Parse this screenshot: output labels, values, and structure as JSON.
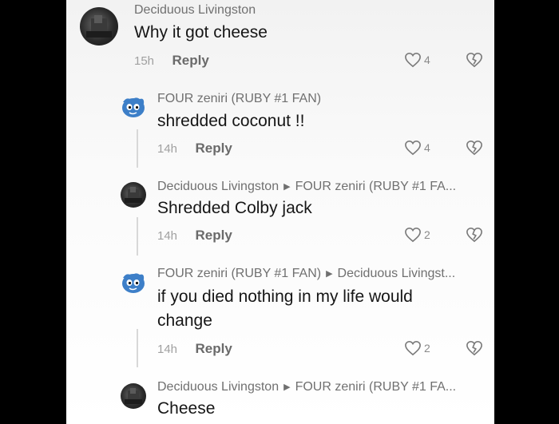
{
  "comments": [
    {
      "username": "Deciduous Livingston",
      "reply_to": "",
      "text": "Why it got cheese",
      "time": "15h",
      "reply_label": "Reply",
      "likes": "4"
    },
    {
      "username": "FOUR zeniri (RUBY #1 FAN)",
      "reply_to": "",
      "text": "shredded coconut !!",
      "time": "14h",
      "reply_label": "Reply",
      "likes": "4"
    },
    {
      "username": "Deciduous Livingston",
      "reply_to": "FOUR zeniri (RUBY #1 FA...",
      "text": "Shredded Colby jack",
      "time": "14h",
      "reply_label": "Reply",
      "likes": "2"
    },
    {
      "username": "FOUR zeniri (RUBY #1 FAN)",
      "reply_to": "Deciduous Livingst...",
      "text": "if you died nothing in my life would change",
      "time": "14h",
      "reply_label": "Reply",
      "likes": "2"
    },
    {
      "username": "Deciduous Livingston",
      "reply_to": "FOUR zeniri (RUBY #1 FA...",
      "text": "Cheese",
      "time": "",
      "reply_label": "",
      "likes": ""
    }
  ]
}
